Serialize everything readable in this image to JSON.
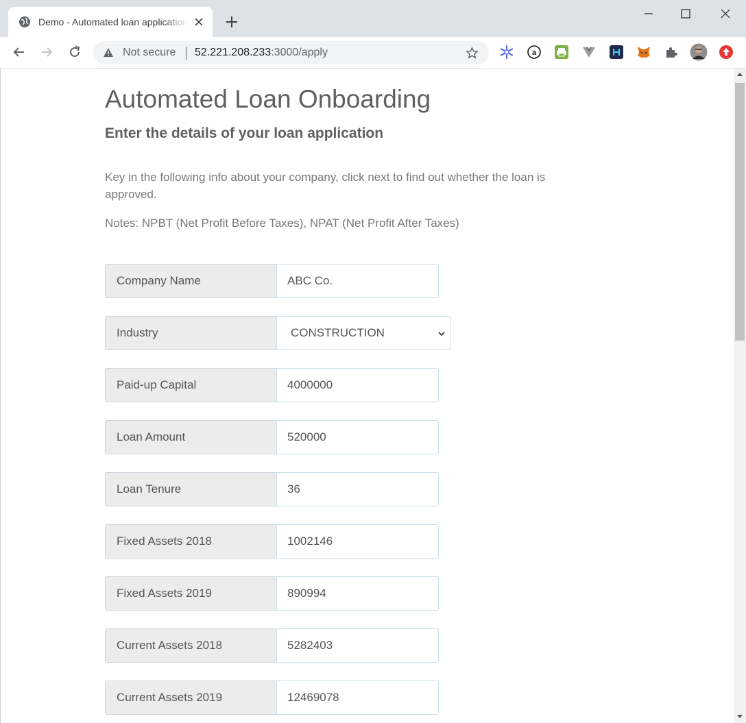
{
  "browser": {
    "tab_title": "Demo - Automated loan application",
    "security_label": "Not secure",
    "url_host": "52.221.208.233",
    "url_path": ":3000/apply"
  },
  "page": {
    "title": "Automated Loan Onboarding",
    "subtitle": "Enter the details of your loan application",
    "intro": "Key in the following info about your company, click next to find out whether the loan is approved.",
    "notes": "Notes: NPBT (Net Profit Before Taxes), NPAT (Net Profit After Taxes)"
  },
  "form": {
    "fields": [
      {
        "label": "Company Name",
        "value": "ABC Co."
      },
      {
        "label": "Industry",
        "value": "CONSTRUCTION"
      },
      {
        "label": "Paid-up Capital",
        "value": "4000000"
      },
      {
        "label": "Loan Amount",
        "value": "520000"
      },
      {
        "label": "Loan Tenure",
        "value": "36"
      },
      {
        "label": "Fixed Assets 2018",
        "value": "1002146"
      },
      {
        "label": "Fixed Assets 2019",
        "value": "890994"
      },
      {
        "label": "Current Assets 2018",
        "value": "5282403"
      },
      {
        "label": "Current Assets 2019",
        "value": "12469078"
      }
    ]
  },
  "colors": {
    "accent_text": "#5f5f5f",
    "label_bg": "#ececec",
    "input_border": "#c9dfe7"
  }
}
